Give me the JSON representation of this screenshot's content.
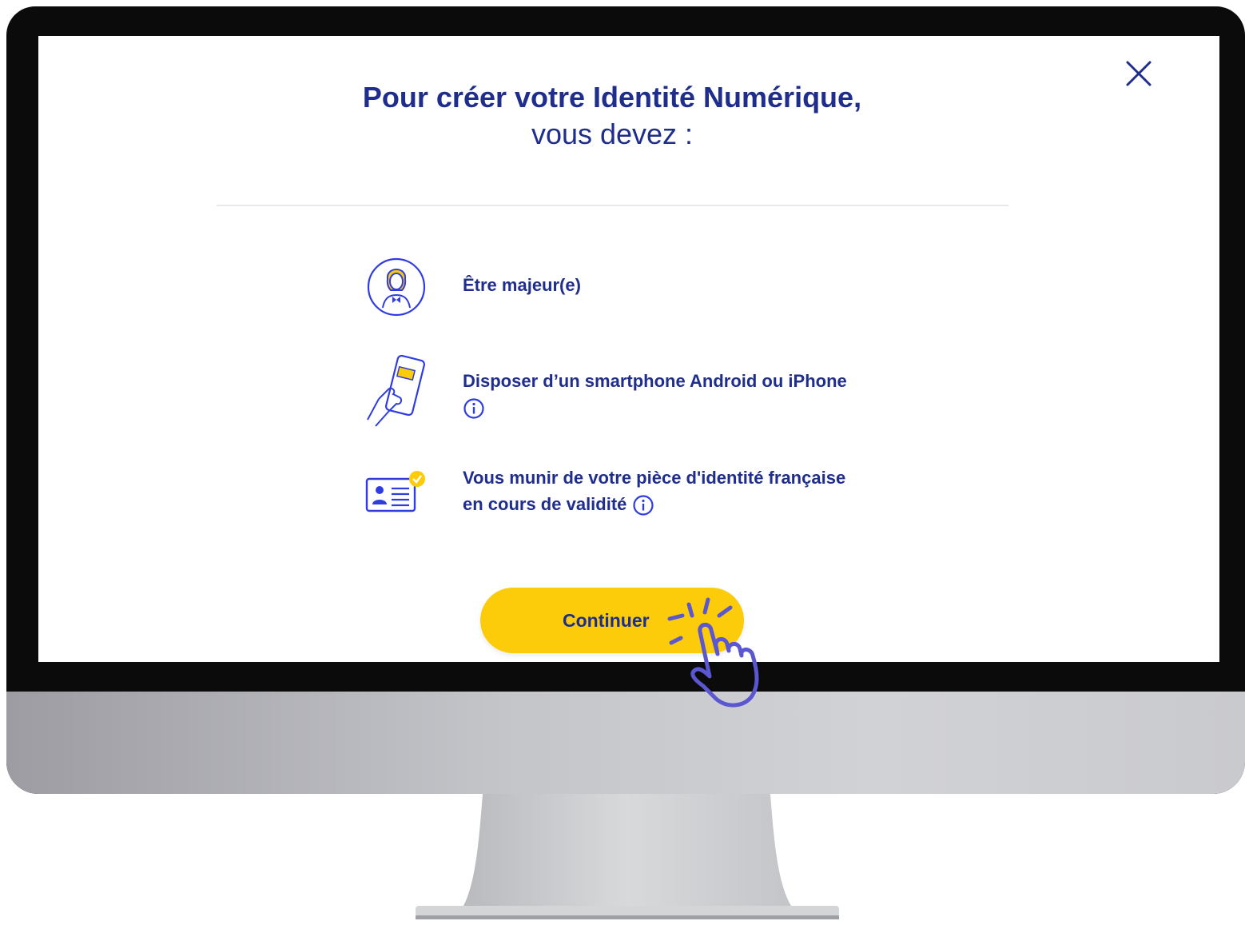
{
  "dialog": {
    "title_line1": "Pour créer votre Identité Numérique,",
    "title_line2": "vous devez :",
    "close_icon": "close-icon"
  },
  "requirements": [
    {
      "icon": "adult-person-icon",
      "text": "Être majeur(e)",
      "info": false
    },
    {
      "icon": "smartphone-hand-icon",
      "text": "Disposer d’un smartphone Android ou iPhone",
      "info": true
    },
    {
      "icon": "id-card-check-icon",
      "text_line1": "Vous munir de votre pièce d'identité française",
      "text_line2": "en cours de validité",
      "info": true
    }
  ],
  "actions": {
    "continue_label": "Continuer"
  },
  "overlay": {
    "pointer_icon": "hand-tap-cursor-icon"
  },
  "colors": {
    "text_primary": "#1f2e8c",
    "icon_stroke": "#2f3ce0",
    "accent_yellow": "#fccb0a",
    "pointer_purple": "#5b57d1",
    "divider": "#e7e8ec"
  }
}
